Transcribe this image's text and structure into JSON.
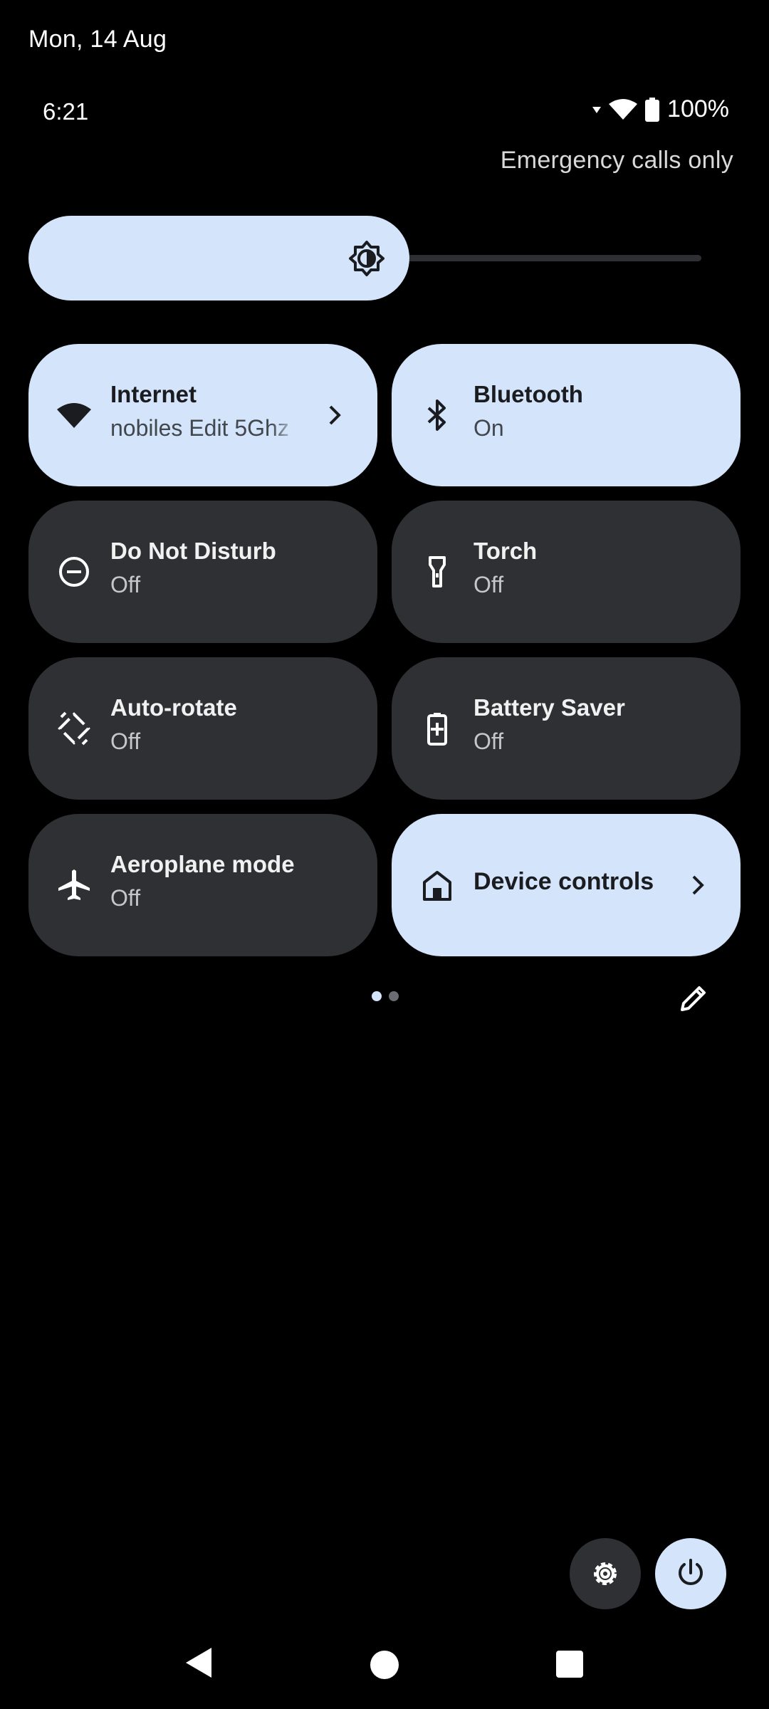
{
  "header": {
    "date": "Mon, 14 Aug",
    "time": "6:21",
    "battery_percent": "100%",
    "carrier_status": "Emergency calls only"
  },
  "brightness": {
    "level": 0.5,
    "icon": "brightness-icon"
  },
  "tiles": [
    {
      "id": "internet",
      "title": "Internet",
      "subtitle": "nobiles Edit 5Ghz",
      "state": "on",
      "icon": "wifi-icon",
      "has_chevron": true
    },
    {
      "id": "bluetooth",
      "title": "Bluetooth",
      "subtitle": "On",
      "state": "on",
      "icon": "bluetooth-icon",
      "has_chevron": false
    },
    {
      "id": "dnd",
      "title": "Do Not Disturb",
      "subtitle": "Off",
      "state": "off",
      "icon": "do-not-disturb-icon",
      "has_chevron": false
    },
    {
      "id": "torch",
      "title": "Torch",
      "subtitle": "Off",
      "state": "off",
      "icon": "torch-icon",
      "has_chevron": false
    },
    {
      "id": "autorotate",
      "title": "Auto-rotate",
      "subtitle": "Off",
      "state": "off",
      "icon": "auto-rotate-icon",
      "has_chevron": false
    },
    {
      "id": "battery-saver",
      "title": "Battery Saver",
      "subtitle": "Off",
      "state": "off",
      "icon": "battery-saver-icon",
      "has_chevron": false
    },
    {
      "id": "aeroplane",
      "title": "Aeroplane mode",
      "subtitle": "Off",
      "state": "off",
      "icon": "airplane-icon",
      "has_chevron": false
    },
    {
      "id": "device-controls",
      "title": "Device controls",
      "state": "on",
      "icon": "home-icon",
      "has_chevron": true
    }
  ],
  "pager": {
    "page": 1,
    "total_pages": 2
  },
  "colors": {
    "tile_on": "#d3e4fb",
    "tile_off": "#2f3033",
    "background": "#000000"
  }
}
